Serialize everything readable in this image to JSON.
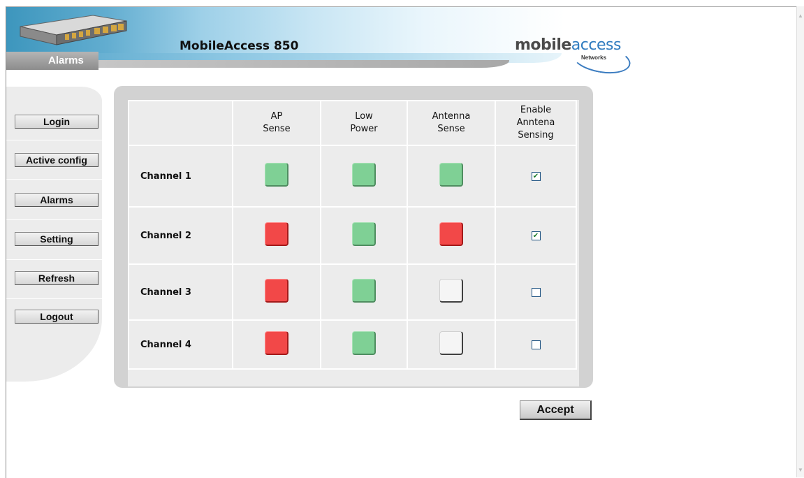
{
  "header": {
    "product_title": "MobileAccess 850",
    "section_tab": "Alarms",
    "logo_main_a": "mobile",
    "logo_main_b": "access",
    "logo_sub": "Networks"
  },
  "sidebar": {
    "items": [
      {
        "label": "Login"
      },
      {
        "label": "Active config"
      },
      {
        "label": "Alarms"
      },
      {
        "label": "Setting"
      },
      {
        "label": "Refresh"
      },
      {
        "label": "Logout"
      }
    ]
  },
  "table": {
    "columns": [
      {
        "line1": "AP",
        "line2": "Sense",
        "line3": ""
      },
      {
        "line1": "Low",
        "line2": "Power",
        "line3": ""
      },
      {
        "line1": "Antenna",
        "line2": "Sense",
        "line3": ""
      },
      {
        "line1": "Enable",
        "line2": "Anntena",
        "line3": "Sensing"
      }
    ],
    "rows": [
      {
        "label": "Channel 1",
        "ap_sense": "green",
        "low_power": "green",
        "antenna_sense": "green",
        "enable_sensing": true
      },
      {
        "label": "Channel 2",
        "ap_sense": "red",
        "low_power": "green",
        "antenna_sense": "red",
        "enable_sensing": true
      },
      {
        "label": "Channel 3",
        "ap_sense": "red",
        "low_power": "green",
        "antenna_sense": "off",
        "enable_sensing": false
      },
      {
        "label": "Channel 4",
        "ap_sense": "red",
        "low_power": "green",
        "antenna_sense": "off",
        "enable_sensing": false
      }
    ]
  },
  "actions": {
    "accept_label": "Accept"
  },
  "colors": {
    "status_green": "#7fd095",
    "status_red": "#f24848",
    "status_off": "#f5f5f5",
    "panel_bg": "#d2d2d2",
    "banner_blue": "#3d96bd"
  }
}
